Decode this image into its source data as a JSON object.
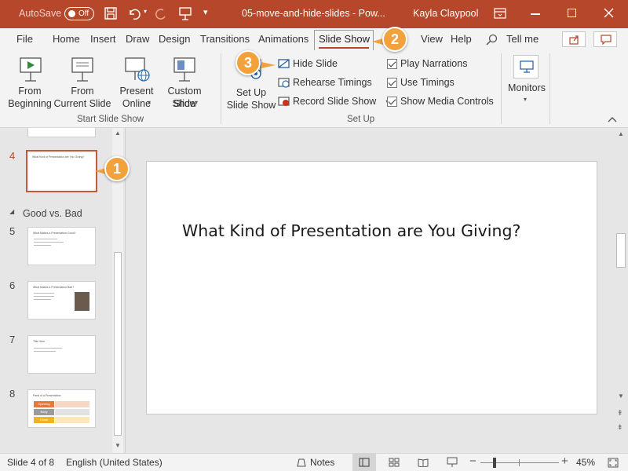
{
  "titlebar": {
    "autosave_label": "AutoSave",
    "autosave_state": "Off",
    "doc_title": "05-move-and-hide-slides - Pow...",
    "user_name": "Kayla Claypool"
  },
  "tabs": [
    {
      "label": "File"
    },
    {
      "label": "Home"
    },
    {
      "label": "Insert"
    },
    {
      "label": "Draw"
    },
    {
      "label": "Design"
    },
    {
      "label": "Transitions"
    },
    {
      "label": "Animations"
    },
    {
      "label": "Slide Show"
    },
    {
      "label": "View"
    },
    {
      "label": "Help"
    }
  ],
  "tell_me": "Tell me",
  "ribbon": {
    "from_beginning": [
      "From",
      "Beginning"
    ],
    "from_current": [
      "From",
      "Current Slide"
    ],
    "present_online": [
      "Present",
      "Online"
    ],
    "custom_show": [
      "Custom Slide",
      "Show"
    ],
    "group_start": "Start Slide Show",
    "setup_show": [
      "Set Up",
      "Slide Show"
    ],
    "hide_slide": "Hide Slide",
    "rehearse": "Rehearse Timings",
    "record": "Record Slide Show",
    "play_narrations": "Play Narrations",
    "use_timings": "Use Timings",
    "show_media": "Show Media Controls",
    "group_setup": "Set Up",
    "monitors": "Monitors"
  },
  "thumbnails": {
    "section_name": "Good vs. Bad",
    "slides": [
      {
        "num": "4",
        "title": "What Kind of Presentation are You Giving?"
      },
      {
        "num": "5",
        "title": "What Makes a Presentation Good?"
      },
      {
        "num": "6",
        "title": "What Makes a Presentation Bad?"
      },
      {
        "num": "7",
        "title": "Title Here"
      },
      {
        "num": "8",
        "title": "Parts of a Presentation"
      }
    ],
    "slide8_labels": [
      "Opening",
      "Body",
      "Close"
    ]
  },
  "slide": {
    "title": "What Kind of Presentation are You Giving?"
  },
  "status": {
    "slide_info": "Slide 4 of 8",
    "language": "English (United States)",
    "notes": "Notes",
    "zoom": "45%"
  },
  "callouts": [
    "1",
    "2",
    "3"
  ],
  "colors": {
    "accent": "#b7472a",
    "callout": "#f2a23c"
  }
}
